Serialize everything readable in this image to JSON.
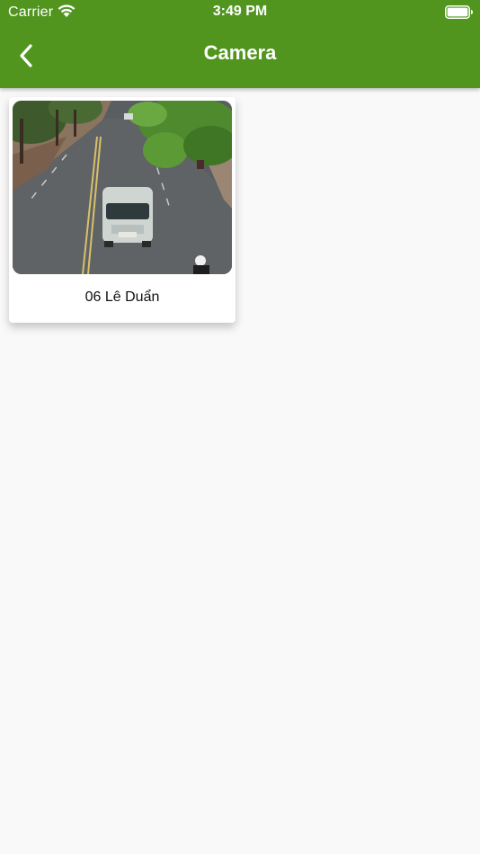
{
  "status_bar": {
    "carrier": "Carrier",
    "time": "3:49 PM",
    "wifi_icon": "wifi-icon",
    "battery_icon": "battery-full-icon"
  },
  "nav": {
    "title": "Camera",
    "back_icon": "chevron-left-icon"
  },
  "colors": {
    "header": "#51951f",
    "background": "#f9f9f9",
    "card": "#ffffff"
  },
  "cameras": [
    {
      "name": "06 Lê Duẩn",
      "thumbnail": "street-traffic-camera-image"
    }
  ]
}
